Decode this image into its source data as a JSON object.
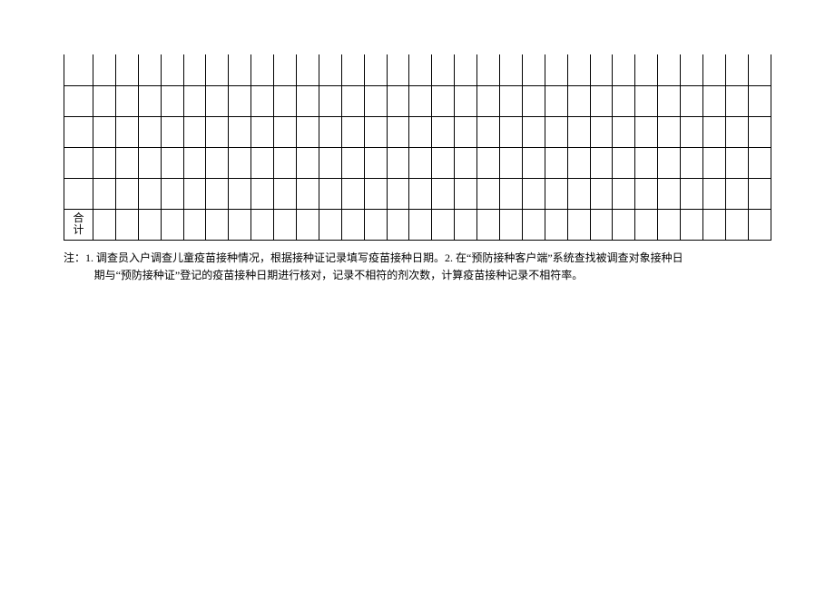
{
  "table": {
    "total_label_line1": "合",
    "total_label_line2": "计",
    "rows": 6,
    "cols": 31
  },
  "note": {
    "prefix": "注：",
    "item1_num": "1.",
    "item1_text": "调查员入户调查儿童疫苗接种情况，根据接种证记录填写疫苗接种日期。",
    "item2_num": "2.",
    "item2_text_part1": "在“预防接种客户端”系统查找被调查对象接种日",
    "item2_text_part2": "期与“预防接种证”登记的疫苗接种日期进行核对，记录不相符的剂次数，计算疫苗接种记录不相符率。"
  }
}
